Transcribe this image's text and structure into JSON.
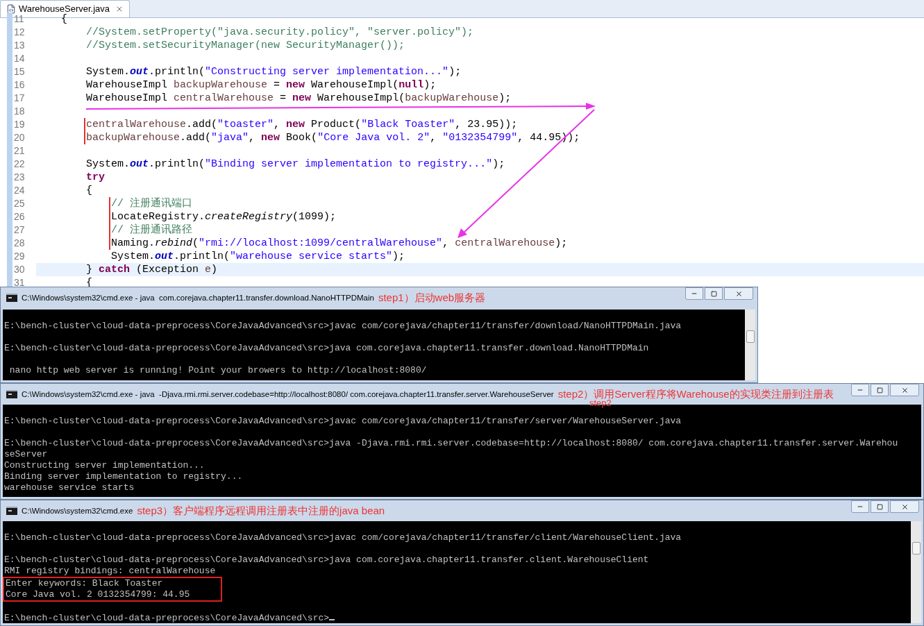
{
  "editor": {
    "tab": {
      "label": "WarehouseServer.java",
      "selected": true
    },
    "lines": [
      {
        "number": "11",
        "current": false,
        "marked": false,
        "tokens": [
          {
            "kind": "plain",
            "text": "    {"
          }
        ]
      },
      {
        "number": "12",
        "current": false,
        "marked": false,
        "tokens": [
          {
            "kind": "comment",
            "text": "        //System.setProperty(\"java.security.policy\", \"server.policy\");"
          }
        ]
      },
      {
        "number": "13",
        "current": false,
        "marked": false,
        "tokens": [
          {
            "kind": "comment",
            "text": "        //System.setSecurityManager(new SecurityManager());"
          }
        ]
      },
      {
        "number": "14",
        "current": false,
        "marked": false
      },
      {
        "number": "15",
        "current": false,
        "marked": false,
        "tokens": [
          {
            "kind": "plain",
            "text": "        System."
          },
          {
            "kind": "field",
            "text": "out"
          },
          {
            "kind": "plain",
            "text": ".println("
          },
          {
            "kind": "string",
            "text": "\"Constructing server implementation...\""
          },
          {
            "kind": "plain",
            "text": ");"
          }
        ]
      },
      {
        "number": "16",
        "current": false,
        "marked": false,
        "tokens": [
          {
            "kind": "plain",
            "text": "        WarehouseImpl "
          },
          {
            "kind": "local",
            "text": "backupWarehouse"
          },
          {
            "kind": "plain",
            "text": " = "
          },
          {
            "kind": "keyword",
            "text": "new"
          },
          {
            "kind": "plain",
            "text": " WarehouseImpl("
          },
          {
            "kind": "keyword",
            "text": "null"
          },
          {
            "kind": "plain",
            "text": ");"
          }
        ]
      },
      {
        "number": "17",
        "current": false,
        "marked": false,
        "tokens": [
          {
            "kind": "plain",
            "text": "        WarehouseImpl "
          },
          {
            "kind": "local",
            "text": "centralWarehouse"
          },
          {
            "kind": "plain",
            "text": " = "
          },
          {
            "kind": "keyword",
            "text": "new"
          },
          {
            "kind": "plain",
            "text": " WarehouseImpl("
          },
          {
            "kind": "local",
            "text": "backupWarehouse"
          },
          {
            "kind": "plain",
            "text": ");"
          }
        ]
      },
      {
        "number": "18",
        "current": false,
        "marked": false
      },
      {
        "number": "19",
        "current": false,
        "marked": true,
        "tokens": [
          {
            "kind": "local",
            "text": "        centralWarehouse"
          },
          {
            "kind": "plain",
            "text": ".add("
          },
          {
            "kind": "string",
            "text": "\"toaster\""
          },
          {
            "kind": "plain",
            "text": ", "
          },
          {
            "kind": "keyword",
            "text": "new"
          },
          {
            "kind": "plain",
            "text": " Product("
          },
          {
            "kind": "string",
            "text": "\"Black Toaster\""
          },
          {
            "kind": "plain",
            "text": ", 23.95));"
          }
        ]
      },
      {
        "number": "20",
        "current": false,
        "marked": true,
        "tokens": [
          {
            "kind": "local",
            "text": "        backupWarehouse"
          },
          {
            "kind": "plain",
            "text": ".add("
          },
          {
            "kind": "string",
            "text": "\"java\""
          },
          {
            "kind": "plain",
            "text": ", "
          },
          {
            "kind": "keyword",
            "text": "new"
          },
          {
            "kind": "plain",
            "text": " Book("
          },
          {
            "kind": "string",
            "text": "\"Core Java vol. 2\""
          },
          {
            "kind": "plain",
            "text": ", "
          },
          {
            "kind": "string",
            "text": "\"0132354799\""
          },
          {
            "kind": "plain",
            "text": ", 44.95));"
          }
        ]
      },
      {
        "number": "21",
        "current": false,
        "marked": false
      },
      {
        "number": "22",
        "current": false,
        "marked": false,
        "tokens": [
          {
            "kind": "plain",
            "text": "        System."
          },
          {
            "kind": "field",
            "text": "out"
          },
          {
            "kind": "plain",
            "text": ".println("
          },
          {
            "kind": "string",
            "text": "\"Binding server implementation to registry...\""
          },
          {
            "kind": "plain",
            "text": ");"
          }
        ]
      },
      {
        "number": "23",
        "current": false,
        "marked": false,
        "tokens": [
          {
            "kind": "keyword",
            "text": "        try"
          }
        ]
      },
      {
        "number": "24",
        "current": false,
        "marked": false,
        "tokens": [
          {
            "kind": "plain",
            "text": "        {"
          }
        ]
      },
      {
        "number": "25",
        "current": false,
        "marked": true,
        "tokens": [
          {
            "kind": "comment",
            "text": "            // 注册通讯端口"
          }
        ]
      },
      {
        "number": "26",
        "current": false,
        "marked": true,
        "tokens": [
          {
            "kind": "plain",
            "text": "            LocateRegistry."
          },
          {
            "kind": "static",
            "text": "createRegistry"
          },
          {
            "kind": "plain",
            "text": "(1099);"
          }
        ]
      },
      {
        "number": "27",
        "current": false,
        "marked": true,
        "tokens": [
          {
            "kind": "comment",
            "text": "            // 注册通讯路径"
          }
        ]
      },
      {
        "number": "28",
        "current": false,
        "marked": true,
        "tokens": [
          {
            "kind": "plain",
            "text": "            Naming."
          },
          {
            "kind": "static",
            "text": "rebind"
          },
          {
            "kind": "plain",
            "text": "("
          },
          {
            "kind": "string",
            "text": "\"rmi://localhost:1099/centralWarehouse\""
          },
          {
            "kind": "plain",
            "text": ", "
          },
          {
            "kind": "local",
            "text": "centralWarehouse"
          },
          {
            "kind": "plain",
            "text": ");"
          }
        ]
      },
      {
        "number": "29",
        "current": false,
        "marked": false,
        "tokens": [
          {
            "kind": "plain",
            "text": "            System."
          },
          {
            "kind": "field",
            "text": "out"
          },
          {
            "kind": "plain",
            "text": ".println("
          },
          {
            "kind": "string",
            "text": "\"warehouse service starts\""
          },
          {
            "kind": "plain",
            "text": ");"
          }
        ]
      },
      {
        "number": "30",
        "current": true,
        "marked": false,
        "tokens": [
          {
            "kind": "plain",
            "text": "        } "
          },
          {
            "kind": "keyword",
            "text": "catch"
          },
          {
            "kind": "plain",
            "text": " (Exception "
          },
          {
            "kind": "local",
            "text": "e"
          },
          {
            "kind": "plain",
            "text": ")"
          }
        ]
      },
      {
        "number": "31",
        "current": false,
        "marked": false,
        "tokens": [
          {
            "kind": "plain",
            "text": "        {"
          }
        ]
      }
    ]
  },
  "consoles": [
    {
      "title": "C:\\Windows\\system32\\cmd.exe - java  com.corejava.chapter11.transfer.download.NanoHTTPDMain",
      "kind": "partial",
      "scrollbar": true,
      "annotations": [
        {
          "kind": "label",
          "text": "step1）启动web服务器"
        }
      ],
      "lines": [
        {
          "kind": "blank"
        },
        {
          "kind": "text",
          "text": "E:\\bench-cluster\\cloud-data-preprocess\\CoreJavaAdvanced\\src>javac com/corejava/chapter11/transfer/download/NanoHTTPDMain.java",
          "boxed": false
        },
        {
          "kind": "blank"
        },
        {
          "kind": "text",
          "text": "E:\\bench-cluster\\cloud-data-preprocess\\CoreJavaAdvanced\\src>java com.corejava.chapter11.transfer.download.NanoHTTPDMain",
          "boxed": false
        },
        {
          "kind": "blank"
        },
        {
          "kind": "text",
          "text": " nano http web server is running! Point your browers to http://localhost:8080/",
          "boxed": false
        }
      ]
    },
    {
      "title": "C:\\Windows\\system32\\cmd.exe - java  -Djava.rmi.rmi.server.codebase=http://localhost:8080/ com.corejava.chapter11.transfer.server.WarehouseServer",
      "kind": "full",
      "scrollbar": false,
      "annotations": [
        {
          "kind": "label",
          "text": "step2）调用Server程序将Warehouse的实现类注册到注册表"
        },
        {
          "kind": "echo",
          "text": "step2"
        }
      ],
      "lines": [
        {
          "kind": "blank"
        },
        {
          "kind": "text",
          "text": "E:\\bench-cluster\\cloud-data-preprocess\\CoreJavaAdvanced\\src>javac com/corejava/chapter11/transfer/server/WarehouseServer.java",
          "boxed": false
        },
        {
          "kind": "blank"
        },
        {
          "kind": "text",
          "text": "E:\\bench-cluster\\cloud-data-preprocess\\CoreJavaAdvanced\\src>java -Djava.rmi.rmi.server.codebase=http://localhost:8080/ com.corejava.chapter11.transfer.server.Warehou",
          "boxed": false
        },
        {
          "kind": "text",
          "text": "seServer",
          "boxed": false
        },
        {
          "kind": "text",
          "text": "Constructing server implementation...",
          "boxed": false
        },
        {
          "kind": "text",
          "text": "Binding server implementation to registry...",
          "boxed": false
        },
        {
          "kind": "text",
          "text": "warehouse service starts",
          "boxed": false
        }
      ]
    },
    {
      "title": "C:\\Windows\\system32\\cmd.exe",
      "kind": "full",
      "scrollbar": true,
      "annotations": [
        {
          "kind": "label",
          "text": "step3）客户端程序远程调用注册表中注册的java bean"
        }
      ],
      "lines": [
        {
          "kind": "blank"
        },
        {
          "kind": "text",
          "text": "E:\\bench-cluster\\cloud-data-preprocess\\CoreJavaAdvanced\\src>javac com/corejava/chapter11/transfer/client/WarehouseClient.java",
          "boxed": false
        },
        {
          "kind": "blank"
        },
        {
          "kind": "text",
          "text": "E:\\bench-cluster\\cloud-data-preprocess\\CoreJavaAdvanced\\src>java com.corejava.chapter11.transfer.client.WarehouseClient",
          "boxed": false
        },
        {
          "kind": "text",
          "text": "RMI registry bindings: centralWarehouse",
          "boxed": false
        },
        {
          "kind": "text",
          "text": "Enter keywords: Black Toaster",
          "boxed": true
        },
        {
          "kind": "text",
          "text": "Core Java vol. 2 0132354799: 44.95",
          "boxed": true
        },
        {
          "kind": "blank"
        },
        {
          "kind": "text",
          "text": "E:\\bench-cluster\\cloud-data-preprocess\\CoreJavaAdvanced\\src>",
          "boxed": false,
          "cursor": true
        }
      ]
    }
  ]
}
